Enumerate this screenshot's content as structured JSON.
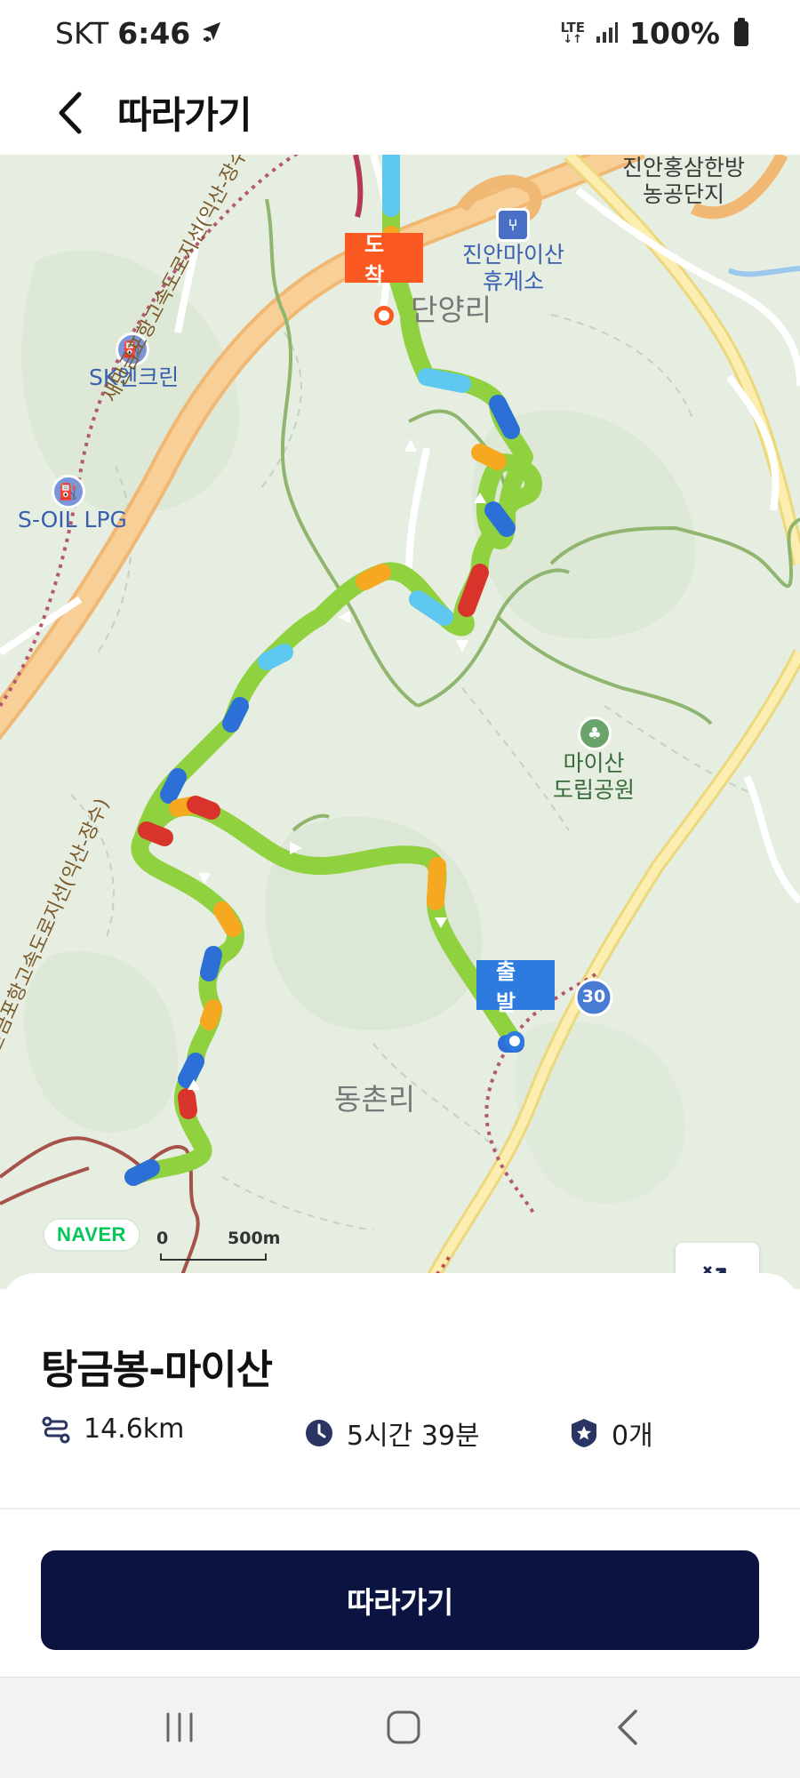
{
  "status_bar": {
    "carrier": "SKT",
    "time": "6:46",
    "network": "LTE",
    "battery": "100%"
  },
  "header": {
    "title": "따라가기",
    "back_icon": "chevron-left-icon"
  },
  "map": {
    "labels": {
      "arrive_flag": "도착",
      "start_flag": "출발",
      "danyang_ri": "단양리",
      "dongchon_ri": "동촌리",
      "rest_area": "진안마이산\n휴게소",
      "complex": "진안홍삼한방\n농공단지",
      "sk_station": "SK엔크린",
      "soil_station": "S-OIL LPG",
      "park": "마이산\n도립공원",
      "expressway_upper": "새만금포항고속도로지선(익산-장수",
      "expressway_lower": "새만금포항고속도로지선(익산-장수)",
      "route_number": "30",
      "naver": "NAVER",
      "scale_zero": "0",
      "scale_distance": "500m"
    },
    "controls": [
      {
        "name": "slope-toggle-icon"
      },
      {
        "name": "swap-direction-icon"
      }
    ],
    "colors": {
      "route_easy": "#8fd13f",
      "route_medium": "#f6a821",
      "route_flat": "#5ec8f0",
      "route_hard": "#2c6fd6",
      "route_steep": "#d9342b",
      "arrive": "#fa5a22",
      "start": "#2e7be0"
    }
  },
  "course": {
    "title": "탕금봉-마이산",
    "distance": "14.6km",
    "duration": "5시간 39분",
    "badges": "0개"
  },
  "actions": {
    "follow_label": "따라가기"
  },
  "nav_bar": {
    "icons": [
      "recents-icon",
      "home-icon",
      "back-icon"
    ]
  }
}
